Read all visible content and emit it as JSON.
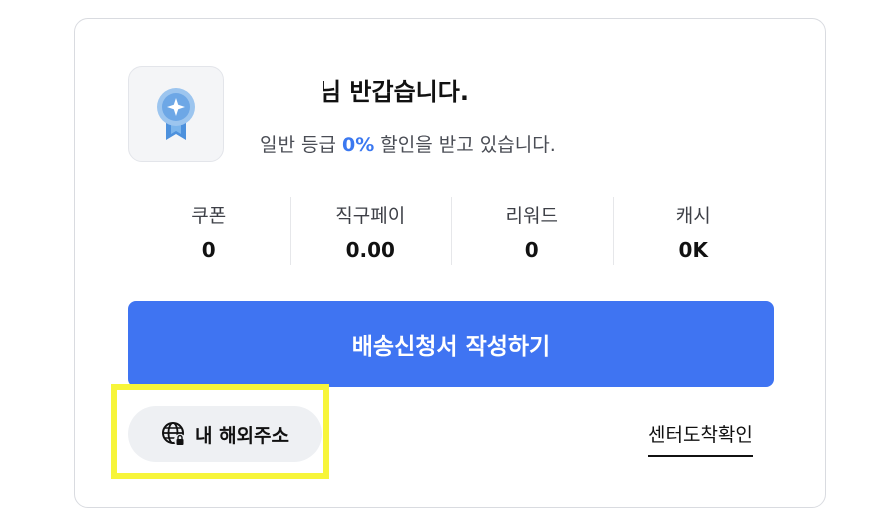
{
  "greeting": {
    "title": "님 반갑습니다.",
    "grade_prefix": "일반 등급 ",
    "grade_percent": "0%",
    "grade_suffix": " 할인을 받고 있습니다."
  },
  "stats": [
    {
      "label": "쿠폰",
      "value": "0"
    },
    {
      "label": "직구페이",
      "value": "0.00"
    },
    {
      "label": "리워드",
      "value": "0"
    },
    {
      "label": "캐시",
      "value": "0K"
    }
  ],
  "actions": {
    "primary_label": "배송신청서 작성하기",
    "address_label": "내 해외주소",
    "center_link_label": "센터도착확인"
  },
  "icons": {
    "badge": "medal-ribbon-icon",
    "address": "globe-lock-icon"
  },
  "colors": {
    "accent": "#3f74f2",
    "percent": "#3b78f0",
    "highlight": "#f7f53a"
  }
}
